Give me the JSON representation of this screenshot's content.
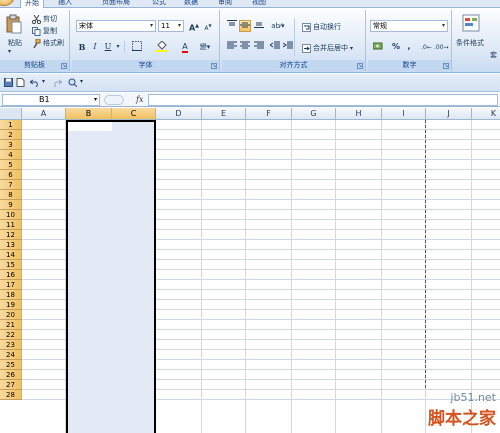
{
  "tabs": [
    {
      "label": "开始",
      "active": true
    },
    {
      "label": "插入",
      "active": false
    },
    {
      "label": "页面布局",
      "active": false
    },
    {
      "label": "公式",
      "active": false
    },
    {
      "label": "数据",
      "active": false
    },
    {
      "label": "审阅",
      "active": false
    },
    {
      "label": "视图",
      "active": false
    }
  ],
  "clipboard": {
    "paste": "粘贴",
    "cut": "剪切",
    "copy": "复制",
    "format_painter": "格式刷",
    "label": "剪贴板"
  },
  "font": {
    "family": "宋体",
    "size": "11",
    "bold": "B",
    "italic": "I",
    "underline": "U",
    "grow": "A",
    "shrink": "A",
    "color_letter": "A",
    "label": "字体"
  },
  "alignment": {
    "wrap": "自动换行",
    "merge": "合并后居中",
    "label": "对齐方式"
  },
  "number": {
    "format": "常规",
    "percent": "%",
    "comma": ",",
    "label": "数字"
  },
  "styles": {
    "conditional": "条件格式",
    "table": "套"
  },
  "formula_bar": {
    "cell_ref": "B1",
    "fx": "fx",
    "value": ""
  },
  "columns": [
    "A",
    "B",
    "C",
    "D",
    "E",
    "F",
    "G",
    "H",
    "I",
    "J",
    "K"
  ],
  "rows": [
    "1",
    "2",
    "3",
    "4",
    "5",
    "6",
    "7",
    "8",
    "9",
    "10",
    "11",
    "12",
    "13",
    "14",
    "15",
    "16",
    "17",
    "18",
    "19",
    "20",
    "21",
    "22",
    "23",
    "24",
    "25",
    "26",
    "27",
    "28"
  ],
  "selected_columns": [
    "B",
    "C"
  ],
  "watermark": {
    "url": "jb51.net",
    "name": "脚本之家"
  },
  "colors": {
    "ribbon": "#dbe7f6",
    "selection": "#e3e9f5",
    "row_header": "#f1c15f",
    "watermark": "#d6521e"
  }
}
